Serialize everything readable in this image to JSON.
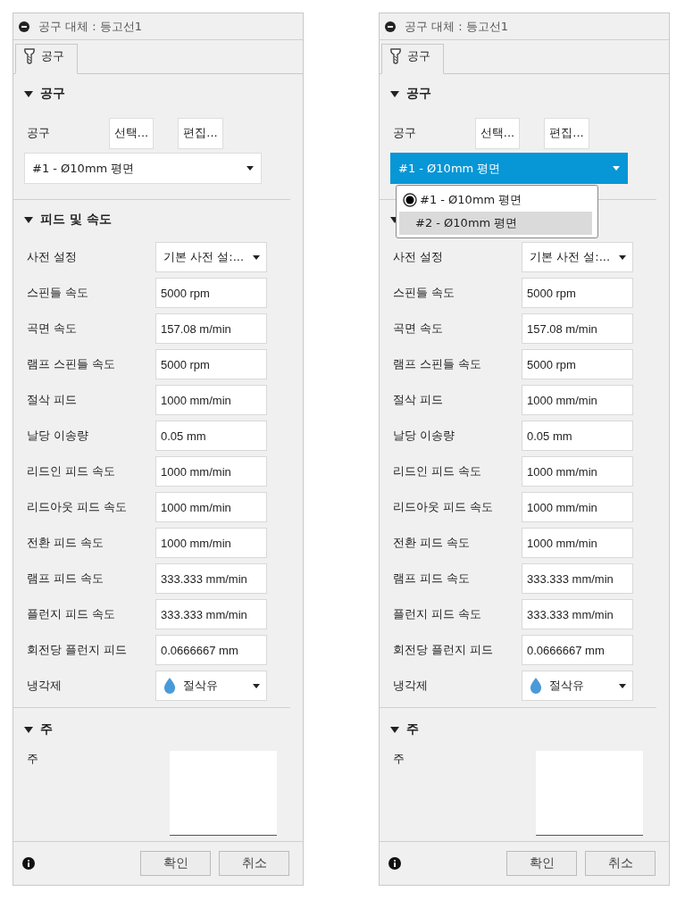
{
  "panels": [
    {
      "title": "공구 대체 : 등고선1",
      "tabs": [
        {
          "label": "공구",
          "selected": true
        }
      ],
      "tool_section": {
        "header": "공구",
        "expanded": true,
        "label": "공구",
        "buttons": [
          "선택...",
          "편집..."
        ],
        "select": {
          "value": "#1 - Ø10mm 평면",
          "open": false
        }
      },
      "feed_section": {
        "header": "피드 및 속도",
        "expanded": true,
        "rows": [
          {
            "kind": "select",
            "label": "사전 설정",
            "value": "기본 사전 설:..."
          },
          {
            "kind": "field",
            "label": "스핀들 속도",
            "value": "5000 rpm"
          },
          {
            "kind": "field",
            "label": "곡면 속도",
            "value": "157.08 m/min"
          },
          {
            "kind": "field",
            "label": "램프 스핀들 속도",
            "value": "5000 rpm"
          },
          {
            "kind": "field",
            "label": "절삭 피드",
            "value": "1000 mm/min"
          },
          {
            "kind": "field",
            "label": "날당 이송량",
            "value": "0.05 mm"
          },
          {
            "kind": "field",
            "label": "리드인 피드 속도",
            "value": "1000 mm/min"
          },
          {
            "kind": "field",
            "label": "리드아웃 피드 속도",
            "value": "1000 mm/min"
          },
          {
            "kind": "field",
            "label": "전환 피드 속도",
            "value": "1000 mm/min"
          },
          {
            "kind": "field",
            "label": "램프 피드 속도",
            "value": "333.333 mm/min"
          },
          {
            "kind": "field",
            "label": "플런지 피드 속도",
            "value": "333.333 mm/min"
          },
          {
            "kind": "field",
            "label": "회전당 플런지 피드",
            "value": "0.0666667 mm"
          },
          {
            "kind": "coolant",
            "label": "냉각제",
            "value": "절삭유"
          }
        ]
      },
      "notes_section": {
        "header": "주",
        "expanded": true,
        "label": "주"
      },
      "footer": {
        "buttons": [
          "확인",
          "취소"
        ]
      }
    },
    {
      "title": "공구 대체 : 등고선1",
      "tabs": [
        {
          "label": "공구",
          "selected": true
        }
      ],
      "tool_section": {
        "header": "공구",
        "expanded": true,
        "label": "공구",
        "buttons": [
          "선택...",
          "편집..."
        ],
        "select": {
          "value": "#1 - Ø10mm 평면",
          "open": true,
          "options": [
            {
              "label": "#1 - Ø10mm 평면",
              "selected": true,
              "highlighted": false
            },
            {
              "label": "#2 - Ø10mm 평면",
              "selected": false,
              "highlighted": true
            }
          ]
        }
      },
      "feed_section": {
        "expanded": true,
        "rows": [
          {
            "kind": "select",
            "label": "사전 설정",
            "value": "기본 사전 설:..."
          },
          {
            "kind": "field",
            "label": "스핀들 속도",
            "value": "5000 rpm"
          },
          {
            "kind": "field",
            "label": "곡면 속도",
            "value": "157.08 m/min"
          },
          {
            "kind": "field",
            "label": "램프 스핀들 속도",
            "value": "5000 rpm"
          },
          {
            "kind": "field",
            "label": "절삭 피드",
            "value": "1000 mm/min"
          },
          {
            "kind": "field",
            "label": "날당 이송량",
            "value": "0.05 mm"
          },
          {
            "kind": "field",
            "label": "리드인 피드 속도",
            "value": "1000 mm/min"
          },
          {
            "kind": "field",
            "label": "리드아웃 피드 속도",
            "value": "1000 mm/min"
          },
          {
            "kind": "field",
            "label": "전환 피드 속도",
            "value": "1000 mm/min"
          },
          {
            "kind": "field",
            "label": "램프 피드 속도",
            "value": "333.333 mm/min"
          },
          {
            "kind": "field",
            "label": "플런지 피드 속도",
            "value": "333.333 mm/min"
          },
          {
            "kind": "field",
            "label": "회전당 플런지 피드",
            "value": "0.0666667 mm"
          },
          {
            "kind": "coolant",
            "label": "냉각제",
            "value": "절삭유"
          }
        ]
      },
      "notes_section": {
        "header": "주",
        "expanded": true,
        "label": "주"
      },
      "footer": {
        "buttons": [
          "확인",
          "취소"
        ]
      }
    }
  ]
}
